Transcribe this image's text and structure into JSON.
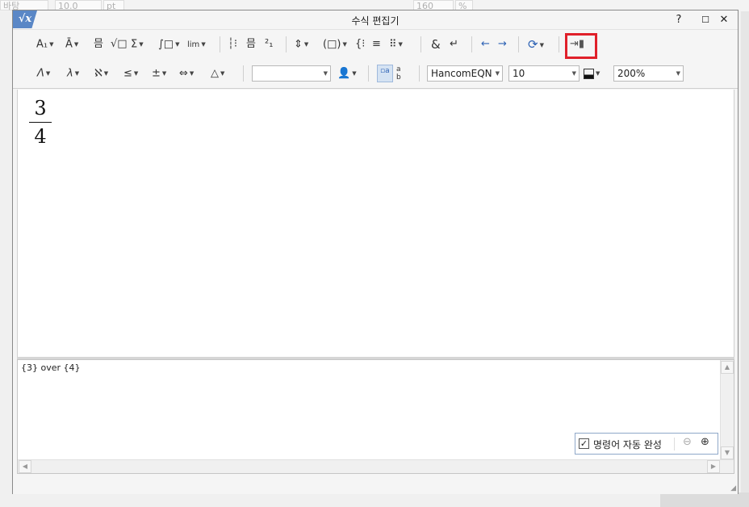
{
  "background": {
    "items": [
      "바탕",
      "10.0",
      "pt",
      "160",
      "%"
    ]
  },
  "dialog": {
    "title": "수식 편집기",
    "icon_label": "√x",
    "help_label": "?",
    "maximize_label": "☐",
    "close_label": "✕"
  },
  "toolbar": {
    "row1": [
      {
        "name": "script-sub-superscript-menu",
        "label": "A₁",
        "dropdown": true
      },
      {
        "name": "decoration-menu",
        "label": "Ā",
        "dropdown": true
      },
      {
        "name": "fraction-button",
        "label": "믐"
      },
      {
        "name": "root-button",
        "label": "√□"
      },
      {
        "name": "sum-menu",
        "label": "Σ",
        "dropdown": true
      },
      {
        "name": "integral-menu",
        "label": "∫□",
        "dropdown": true
      },
      {
        "name": "limit-menu",
        "label": "lim",
        "dropdown": true
      },
      {
        "name": "column-vector-button",
        "label": "┆⁝"
      },
      {
        "name": "matrix-row-button",
        "label": "믐"
      },
      {
        "name": "binomial-button",
        "label": "²₁"
      },
      {
        "name": "bracket-menu",
        "label": "⇕",
        "dropdown": true
      },
      {
        "name": "parenthesis-menu",
        "label": "(□)",
        "dropdown": true
      },
      {
        "name": "cases-button",
        "label": "{⁝"
      },
      {
        "name": "align-rows-button",
        "label": "≡"
      },
      {
        "name": "matrix-menu",
        "label": "⠿",
        "dropdown": true
      },
      {
        "name": "ampersand-button",
        "label": "&"
      },
      {
        "name": "newline-button",
        "label": "↵"
      },
      {
        "name": "undo-button",
        "label": "←"
      },
      {
        "name": "redo-button",
        "label": "→"
      },
      {
        "name": "refresh-menu",
        "label": "⟳",
        "dropdown": true
      },
      {
        "name": "exit-button",
        "label": "⇥▮"
      }
    ],
    "row2": [
      {
        "name": "greek-upper-menu",
        "label": "Λ",
        "dropdown": true
      },
      {
        "name": "greek-lower-menu",
        "label": "λ",
        "dropdown": true
      },
      {
        "name": "hebrew-menu",
        "label": "ℵ",
        "dropdown": true
      },
      {
        "name": "relation-menu",
        "label": "≤",
        "dropdown": true
      },
      {
        "name": "operator-menu",
        "label": "±",
        "dropdown": true
      },
      {
        "name": "arrow-menu",
        "label": "⇔",
        "dropdown": true
      },
      {
        "name": "misc-symbol-menu",
        "label": "△",
        "dropdown": true
      }
    ],
    "style_combo": "",
    "font_combo": "HancomEQN",
    "size_combo": "10",
    "zoom_combo": "200%"
  },
  "canvas": {
    "numerator": "3",
    "denominator": "4"
  },
  "script": {
    "text": "{3} over {4}"
  },
  "autocomplete": {
    "checked": "✓",
    "label": "명령어 자동 완성"
  }
}
